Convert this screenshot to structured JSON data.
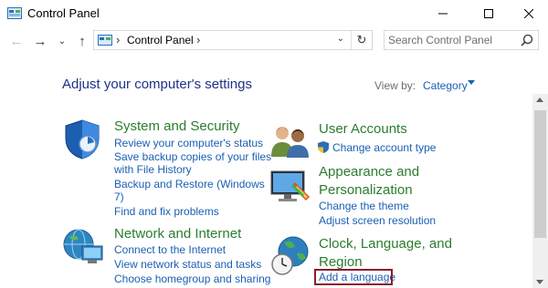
{
  "window": {
    "title": "Control Panel",
    "minimize_icon": "minimize-icon",
    "maximize_icon": "maximize-icon",
    "close_icon": "close-icon"
  },
  "toolbar": {
    "address_path": "Control Panel",
    "search_placeholder": "Search Control Panel"
  },
  "content": {
    "heading": "Adjust your computer's settings",
    "view_by_label": "View by:",
    "view_by_value": "Category"
  },
  "categories": {
    "system_security": {
      "title": "System and Security",
      "links": [
        "Review your computer's status",
        "Save backup copies of your files",
        "with File History",
        "Backup and Restore (Windows",
        "7)",
        "Find and fix problems"
      ]
    },
    "network_internet": {
      "title": "Network and Internet",
      "links": [
        "Connect to the Internet",
        "View network status and tasks",
        "Choose homegroup and sharing"
      ]
    },
    "user_accounts": {
      "title": "User Accounts",
      "links": [
        "Change account type"
      ]
    },
    "appearance": {
      "title_line1": "Appearance and",
      "title_line2": "Personalization",
      "links": [
        "Change the theme",
        "Adjust screen resolution"
      ]
    },
    "clock_language": {
      "title_line1": "Clock, Language, and",
      "title_line2": "Region",
      "links": [
        "Add a language"
      ]
    }
  }
}
